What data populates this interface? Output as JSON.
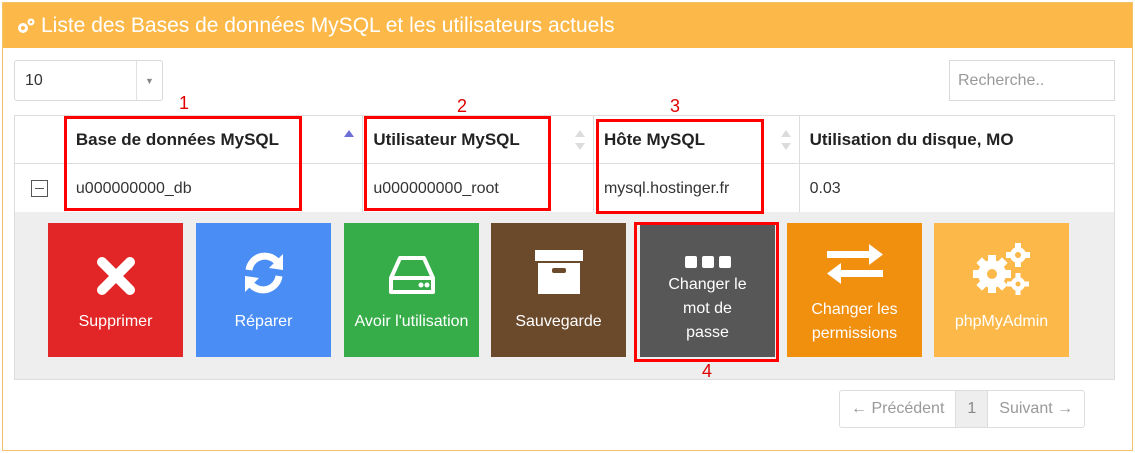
{
  "panel": {
    "title": "Liste des Bases de données MySQL et les utilisateurs actuels"
  },
  "length_select": {
    "value": "10"
  },
  "search": {
    "placeholder": "Recherche.."
  },
  "table": {
    "headers": [
      "Base de données MySQL",
      "Utilisateur MySQL",
      "Hôte MySQL",
      "Utilisation du disque, MO"
    ],
    "rows": [
      {
        "database": "u000000000_db",
        "user": "u000000000_root",
        "host": "mysql.hostinger.fr",
        "disk_usage": "0.03"
      }
    ]
  },
  "actions": [
    {
      "label": "Supprimer",
      "icon": "x-icon",
      "color": "#e22526"
    },
    {
      "label": "Réparer",
      "icon": "refresh-icon",
      "color": "#4a8ef5"
    },
    {
      "label": "Avoir l'utilisation",
      "icon": "hard-drive-icon",
      "color": "#37ad4a"
    },
    {
      "label": "Sauvegarde",
      "icon": "archive-box-icon",
      "color": "#6b4a2c"
    },
    {
      "label": "Changer le mot de passe",
      "icon": "ellipsis-icon",
      "color": "#575757"
    },
    {
      "label": "Changer les permissions",
      "icon": "swap-arrows-icon",
      "color": "#f18f0e"
    },
    {
      "label": "phpMyAdmin",
      "icon": "gears-icon",
      "color": "#fcb848"
    }
  ],
  "annotations": [
    "1",
    "2",
    "3",
    "4"
  ],
  "pagination": {
    "prev": "← Précédent",
    "current": "1",
    "next": "Suivant →"
  },
  "colors": {
    "header_bg": "#fcb848",
    "annotation": "#ff0000"
  }
}
